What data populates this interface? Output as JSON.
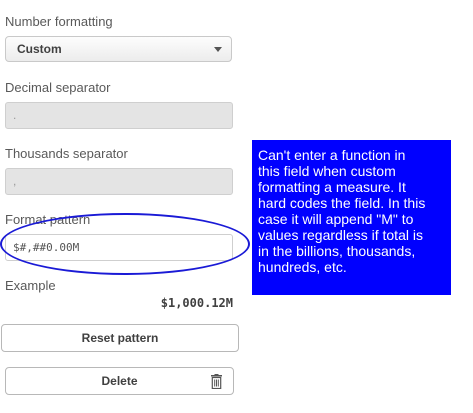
{
  "number_formatting": {
    "label": "Number formatting",
    "selected": "Custom"
  },
  "decimal_separator": {
    "label": "Decimal separator",
    "value": "."
  },
  "thousands_separator": {
    "label": "Thousands separator",
    "value": ","
  },
  "format_pattern": {
    "label": "Format pattern",
    "value": "$#,##0.00M"
  },
  "example": {
    "label": "Example",
    "value": "$1,000.12M"
  },
  "buttons": {
    "reset_label": "Reset pattern",
    "delete_label": "Delete"
  },
  "annotation": {
    "text": "Can't enter a function in\nthis field when custom\nformatting a measure. It\nhard codes the field. In this\ncase it will append \"M\" to\nvalues regardless if total is\nin the billions, thousands,\nhundreds, etc.",
    "background_color": "#0000ff",
    "ellipse_color": "#1a1ad6"
  }
}
